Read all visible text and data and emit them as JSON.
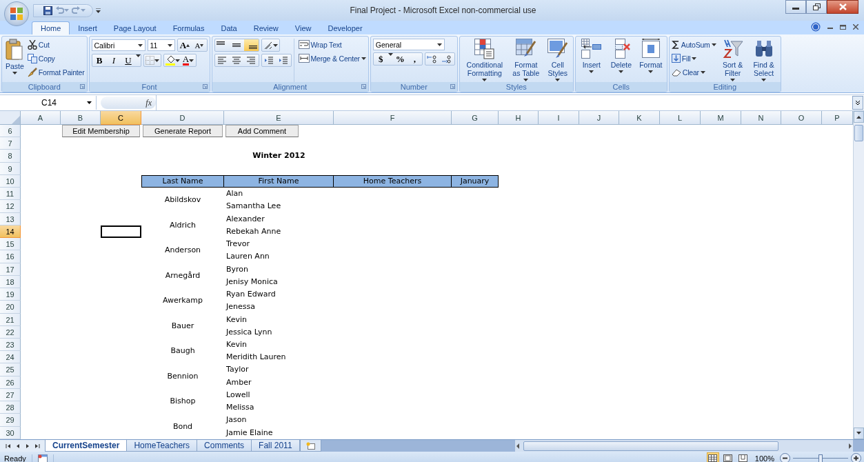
{
  "window": {
    "title": "Final Project - Microsoft Excel non-commercial use"
  },
  "ribbon_tabs": [
    {
      "label": "Home",
      "selected": true
    },
    {
      "label": "Insert",
      "selected": false
    },
    {
      "label": "Page Layout",
      "selected": false
    },
    {
      "label": "Formulas",
      "selected": false
    },
    {
      "label": "Data",
      "selected": false
    },
    {
      "label": "Review",
      "selected": false
    },
    {
      "label": "View",
      "selected": false
    },
    {
      "label": "Developer",
      "selected": false
    }
  ],
  "ribbon_groups": [
    {
      "label": "Clipboard",
      "kind": "clipboard",
      "large": "Paste",
      "small": [
        "Cut",
        "Copy",
        "Format Painter"
      ]
    },
    {
      "label": "Font",
      "kind": "font",
      "font_name": "Calibri",
      "font_size": "11",
      "grow": "A",
      "shrink": "A",
      "styles": [
        "B",
        "I",
        "U"
      ],
      "font_color": "A"
    },
    {
      "label": "Alignment",
      "kind": "alignment",
      "vertical_align": [
        {
          "selected": false
        },
        {
          "selected": false
        },
        {
          "selected": true
        }
      ],
      "wrap": "Wrap Text",
      "merge": "Merge & Center"
    },
    {
      "label": "Number",
      "kind": "number",
      "format": "General",
      "symbols": [
        "$",
        "%",
        ","
      ]
    },
    {
      "label": "Styles",
      "kind": "large",
      "commands": [
        "Conditional Formatting",
        "Format as Table",
        "Cell Styles"
      ]
    },
    {
      "label": "Cells",
      "kind": "large",
      "commands": [
        "Insert",
        "Delete",
        "Format"
      ]
    },
    {
      "label": "Editing",
      "kind": "editing",
      "small": [
        "AutoSum",
        "Fill",
        "Clear"
      ],
      "commands": [
        "Sort & Filter",
        "Find & Select"
      ]
    }
  ],
  "formula_bar": {
    "name_box": "C14",
    "fx": "fx"
  },
  "columns": [
    {
      "label": "A",
      "selected": false
    },
    {
      "label": "B",
      "selected": false
    },
    {
      "label": "C",
      "selected": true
    },
    {
      "label": "D",
      "selected": false
    },
    {
      "label": "E",
      "selected": false
    },
    {
      "label": "F",
      "selected": false
    },
    {
      "label": "G",
      "selected": false
    },
    {
      "label": "H",
      "selected": false
    },
    {
      "label": "I",
      "selected": false
    },
    {
      "label": "J",
      "selected": false
    },
    {
      "label": "K",
      "selected": false
    },
    {
      "label": "L",
      "selected": false
    },
    {
      "label": "M",
      "selected": false
    },
    {
      "label": "N",
      "selected": false
    },
    {
      "label": "O",
      "selected": false
    },
    {
      "label": "P",
      "selected": false
    }
  ],
  "rows": [
    {
      "label": "6",
      "selected": false
    },
    {
      "label": "7",
      "selected": false
    },
    {
      "label": "8",
      "selected": false
    },
    {
      "label": "9",
      "selected": false
    },
    {
      "label": "10",
      "selected": false
    },
    {
      "label": "11",
      "selected": false
    },
    {
      "label": "12",
      "selected": false
    },
    {
      "label": "13",
      "selected": false
    },
    {
      "label": "14",
      "selected": true
    },
    {
      "label": "15",
      "selected": false
    },
    {
      "label": "16",
      "selected": false
    },
    {
      "label": "17",
      "selected": false
    },
    {
      "label": "18",
      "selected": false
    },
    {
      "label": "19",
      "selected": false
    },
    {
      "label": "20",
      "selected": false
    },
    {
      "label": "21",
      "selected": false
    },
    {
      "label": "22",
      "selected": false
    },
    {
      "label": "23",
      "selected": false
    },
    {
      "label": "24",
      "selected": false
    },
    {
      "label": "25",
      "selected": false
    },
    {
      "label": "26",
      "selected": false
    },
    {
      "label": "27",
      "selected": false
    },
    {
      "label": "28",
      "selected": false
    },
    {
      "label": "29",
      "selected": false
    },
    {
      "label": "30",
      "selected": false
    }
  ],
  "sheet_buttons": [
    "Edit Membership",
    "Generate Report",
    "Add Comment"
  ],
  "heading": "Winter 2012",
  "table": {
    "columns": [
      "Last Name",
      "First Name",
      "Home Teachers",
      "January"
    ],
    "families": [
      {
        "last_name": "Abildskov",
        "first_names": [
          "Alan",
          "Samantha Lee"
        ]
      },
      {
        "last_name": "Aldrich",
        "first_names": [
          "Alexander",
          "Rebekah Anne"
        ]
      },
      {
        "last_name": "Anderson",
        "first_names": [
          "Trevor",
          "Lauren Ann"
        ]
      },
      {
        "last_name": "Arnegård",
        "first_names": [
          "Byron",
          "Jenisy Monica"
        ]
      },
      {
        "last_name": "Awerkamp",
        "first_names": [
          "Ryan Edward",
          "Jenessa"
        ]
      },
      {
        "last_name": "Bauer",
        "first_names": [
          "Kevin",
          "Jessica Lynn"
        ]
      },
      {
        "last_name": "Baugh",
        "first_names": [
          "Kevin",
          "Meridith Lauren"
        ]
      },
      {
        "last_name": "Bennion",
        "first_names": [
          "Taylor",
          "Amber"
        ]
      },
      {
        "last_name": "Bishop",
        "first_names": [
          "Lowell",
          "Melissa"
        ]
      },
      {
        "last_name": "Bond",
        "first_names": [
          "Jason",
          "Jamie Elaine"
        ]
      }
    ]
  },
  "sheet_tabs": [
    {
      "label": "CurrentSemester",
      "selected": true
    },
    {
      "label": "HomeTeachers",
      "selected": false
    },
    {
      "label": "Comments",
      "selected": false
    },
    {
      "label": "Fall 2011",
      "selected": false
    }
  ],
  "status_bar": {
    "status": "Ready",
    "views": [
      {
        "selected": true
      },
      {
        "selected": false
      },
      {
        "selected": false
      }
    ],
    "zoom": "100%",
    "zoom_slider": {
      "level": 0.5
    }
  }
}
